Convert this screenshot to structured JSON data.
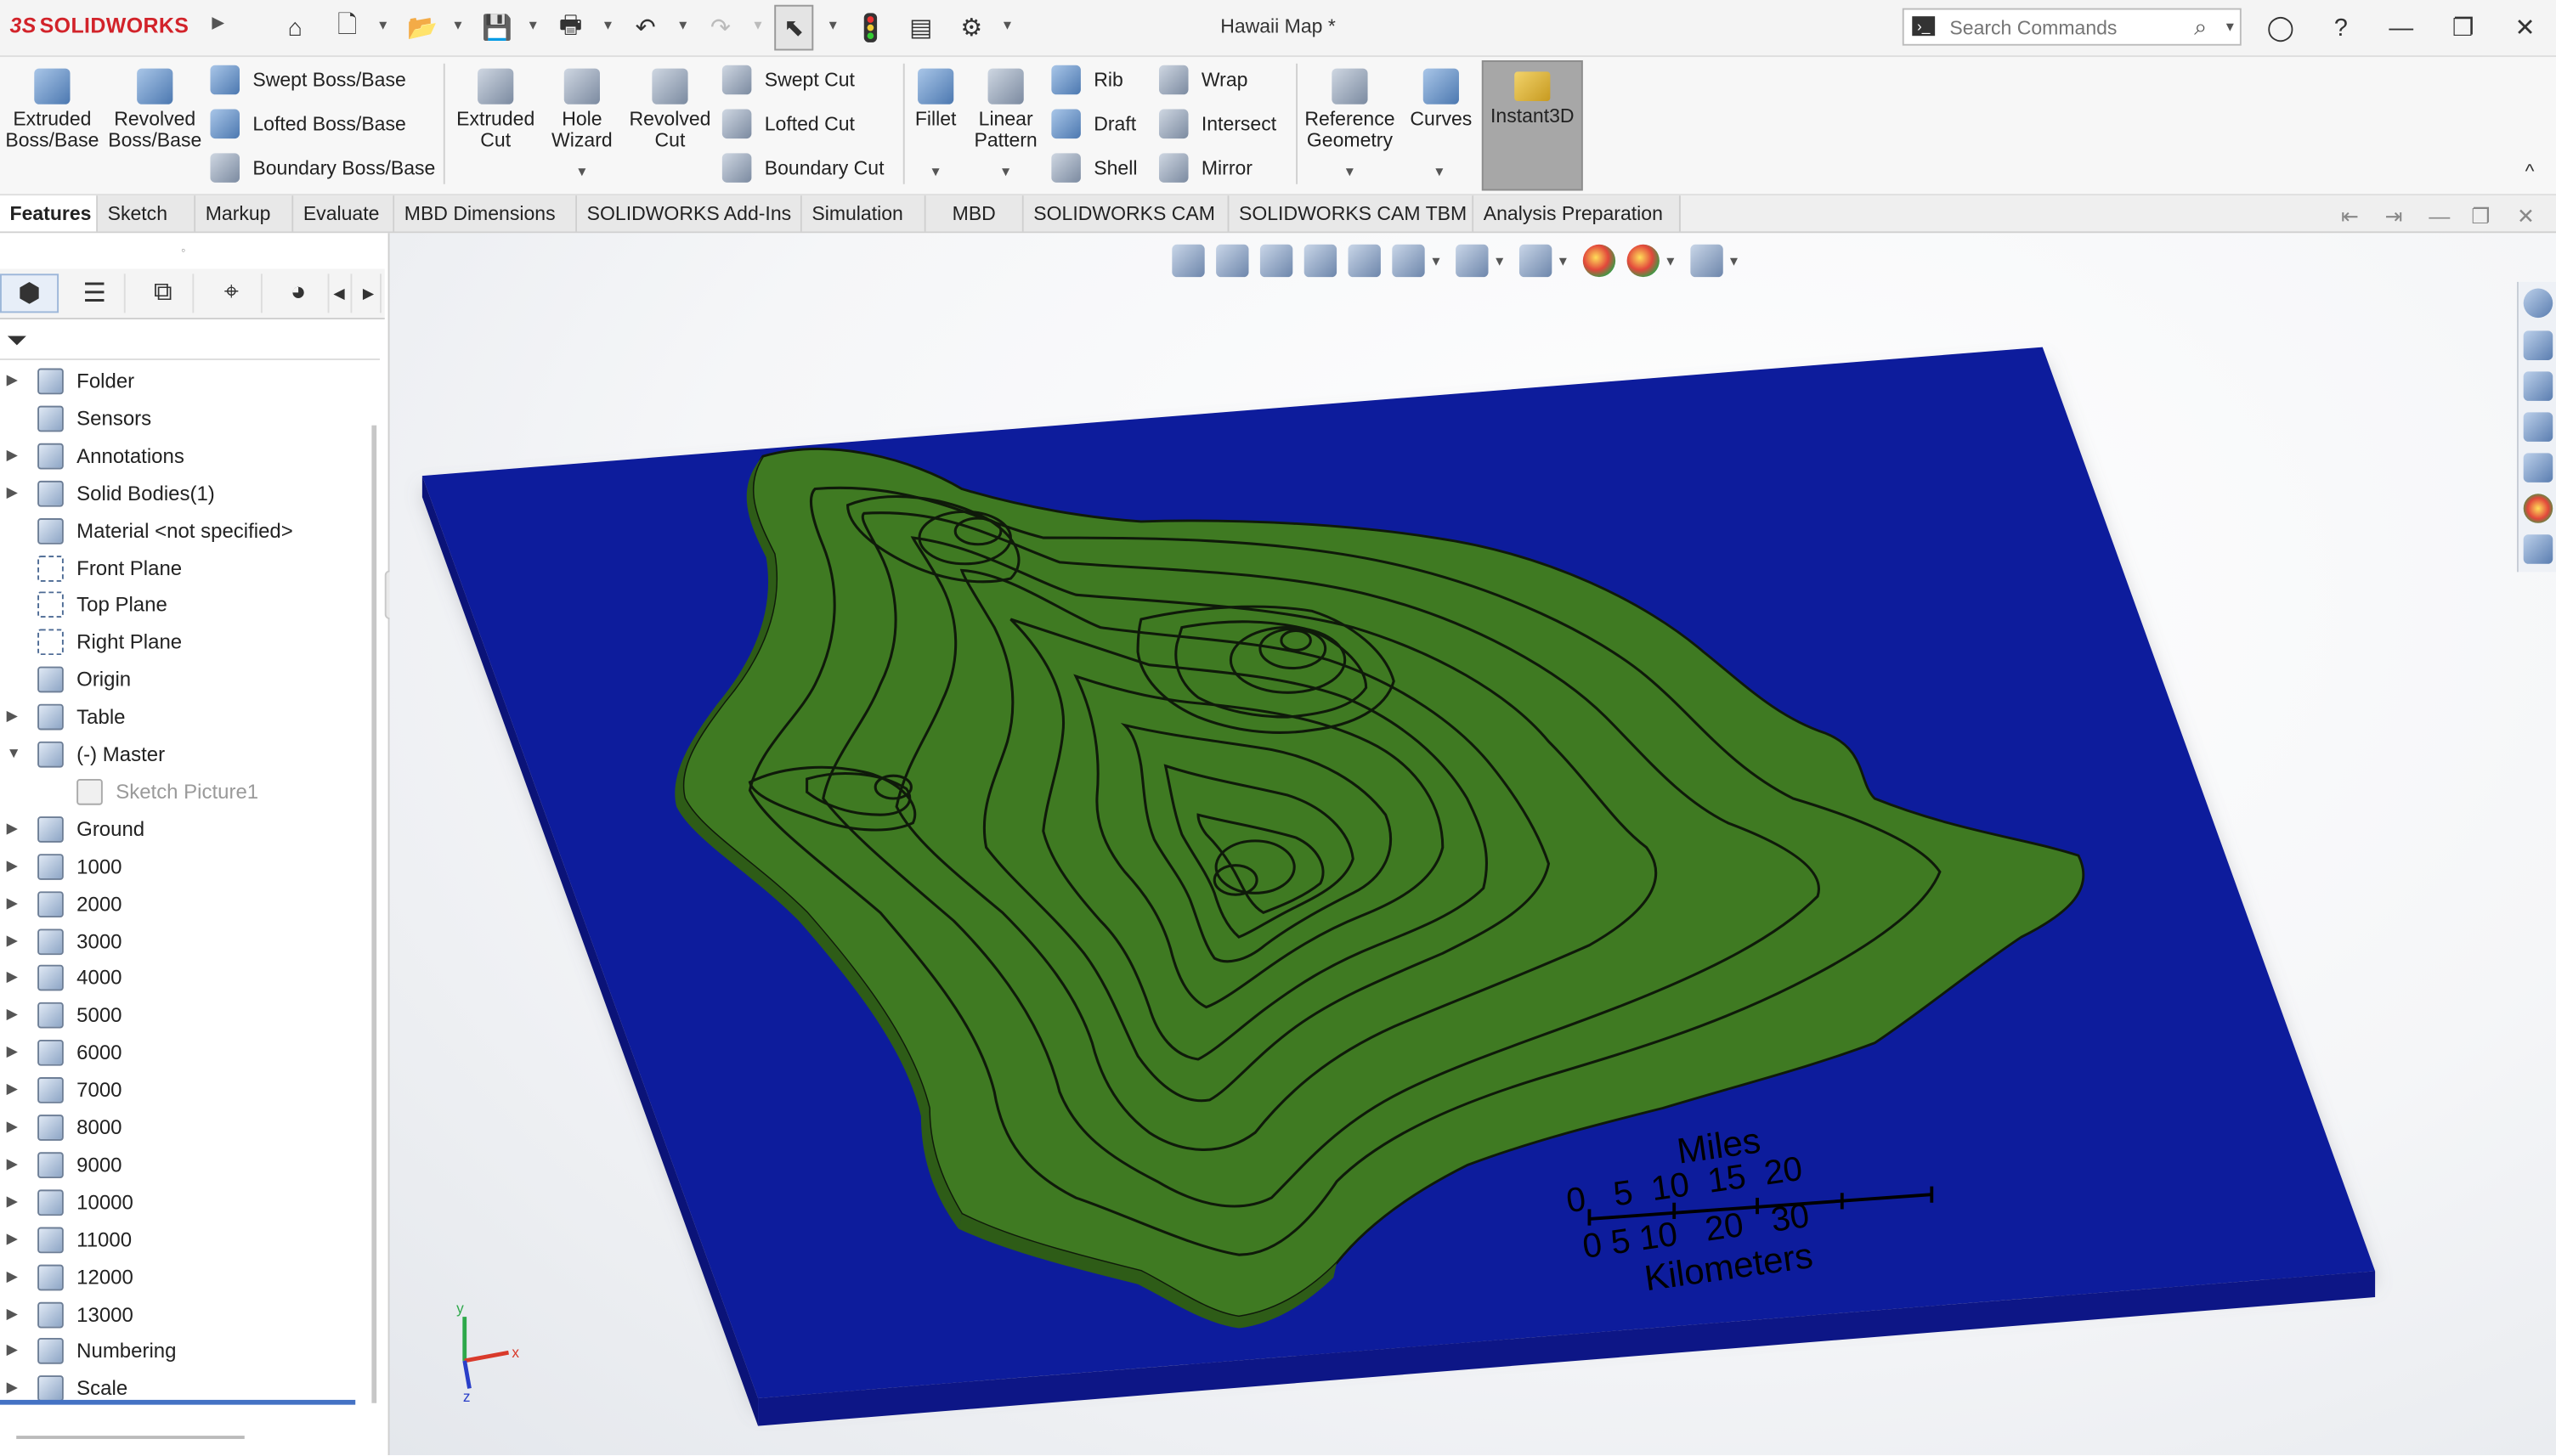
{
  "app": {
    "brand_prefix": "3S",
    "brand_name": "SOLIDWORKS",
    "document_title": "Hawaii Map *",
    "search_placeholder": "Search Commands"
  },
  "quick_access": [
    "home-icon",
    "new-document-icon",
    "open-folder-icon",
    "save-icon",
    "print-icon",
    "undo-icon",
    "redo-icon",
    "select-arrow-icon",
    "traffic-light-icon",
    "file-properties-icon",
    "options-gear-icon"
  ],
  "window_controls": [
    "user-icon",
    "help-icon",
    "minimize-icon",
    "restore-icon",
    "close-icon"
  ],
  "ribbon": {
    "extruded_boss": "Extruded Boss/Base",
    "revolved_boss": "Revolved Boss/Base",
    "swept_boss": "Swept Boss/Base",
    "lofted_boss": "Lofted Boss/Base",
    "boundary_boss": "Boundary Boss/Base",
    "extruded_cut": "Extruded Cut",
    "hole_wizard": "Hole Wizard",
    "revolved_cut": "Revolved Cut",
    "swept_cut": "Swept Cut",
    "lofted_cut": "Lofted Cut",
    "boundary_cut": "Boundary Cut",
    "fillet": "Fillet",
    "linear_pattern": "Linear Pattern",
    "rib": "Rib",
    "draft": "Draft",
    "shell": "Shell",
    "wrap": "Wrap",
    "intersect": "Intersect",
    "mirror": "Mirror",
    "reference_geometry": "Reference Geometry",
    "curves": "Curves",
    "instant3d": "Instant3D"
  },
  "tabs": [
    "Features",
    "Sketch",
    "Markup",
    "Evaluate",
    "MBD Dimensions",
    "SOLIDWORKS Add-Ins",
    "Simulation",
    "MBD",
    "SOLIDWORKS CAM",
    "SOLIDWORKS CAM TBM",
    "Analysis Preparation"
  ],
  "active_tab": "Features",
  "tree": [
    {
      "label": "Folder",
      "expander": true
    },
    {
      "label": "Sensors",
      "expander": false
    },
    {
      "label": "Annotations",
      "expander": true
    },
    {
      "label": "Solid Bodies(1)",
      "expander": true
    },
    {
      "label": "Material <not specified>",
      "expander": false
    },
    {
      "label": "Front Plane",
      "expander": false
    },
    {
      "label": "Top Plane",
      "expander": false
    },
    {
      "label": "Right Plane",
      "expander": false
    },
    {
      "label": "Origin",
      "expander": false
    },
    {
      "label": "Table",
      "expander": true
    },
    {
      "label": "(-) Master",
      "expander": true,
      "expanded": true
    },
    {
      "label": "Sketch Picture1",
      "expander": false,
      "dim": true
    },
    {
      "label": "Ground",
      "expander": true
    },
    {
      "label": "1000",
      "expander": true
    },
    {
      "label": "2000",
      "expander": true
    },
    {
      "label": "3000",
      "expander": true
    },
    {
      "label": "4000",
      "expander": true
    },
    {
      "label": "5000",
      "expander": true
    },
    {
      "label": "6000",
      "expander": true
    },
    {
      "label": "7000",
      "expander": true
    },
    {
      "label": "8000",
      "expander": true
    },
    {
      "label": "9000",
      "expander": true
    },
    {
      "label": "10000",
      "expander": true
    },
    {
      "label": "11000",
      "expander": true
    },
    {
      "label": "12000",
      "expander": true
    },
    {
      "label": "13000",
      "expander": true
    },
    {
      "label": "Numbering",
      "expander": true
    },
    {
      "label": "Scale",
      "expander": true
    }
  ],
  "model": {
    "scale_miles_title": "Miles",
    "scale_miles_ticks": "0   5  10  15  20",
    "scale_km_ticks": "0 5 10   20   30",
    "scale_km_title": "Kilometers",
    "colors": {
      "ocean": "#101a9c",
      "ocean_side": "#0b1378",
      "land": "#3f7a22",
      "contour": "#0f1a0a"
    }
  },
  "triad": {
    "x": "x",
    "y": "y",
    "z": "z"
  }
}
